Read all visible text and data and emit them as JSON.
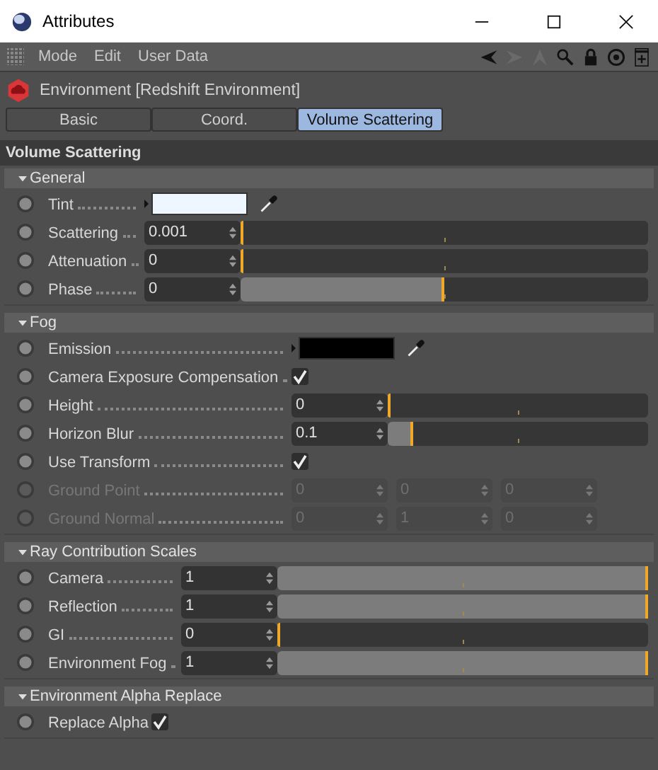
{
  "window": {
    "title": "Attributes"
  },
  "menu": [
    "Mode",
    "Edit",
    "User Data"
  ],
  "object": {
    "title": "Environment [Redshift Environment]"
  },
  "tabs": [
    {
      "label": "Basic",
      "selected": false
    },
    {
      "label": "Coord.",
      "selected": false
    },
    {
      "label": "Volume Scattering",
      "selected": true
    }
  ],
  "panel_title": "Volume Scattering",
  "sections": [
    {
      "title": "General",
      "expanded": true,
      "rows": [
        {
          "kind": "color",
          "label": "Tint",
          "color": "#eef7ff",
          "disabled": false
        },
        {
          "kind": "slider",
          "label": "Scattering",
          "value": "0.001",
          "level": 0,
          "disabled": false
        },
        {
          "kind": "slider",
          "label": "Attenuation",
          "value": "0",
          "level": 0,
          "disabled": false
        },
        {
          "kind": "slider",
          "label": "Phase",
          "value": "0",
          "level": 0.5,
          "disabled": false
        }
      ]
    },
    {
      "title": "Fog",
      "expanded": true,
      "rows": [
        {
          "kind": "color",
          "label": "Emission",
          "color": "#000000",
          "disabled": false
        },
        {
          "kind": "checkbox",
          "label": "Camera Exposure Compensation",
          "checked": true,
          "disabled": false
        },
        {
          "kind": "slider",
          "label": "Height",
          "value": "0",
          "level": 0,
          "disabled": false
        },
        {
          "kind": "slider",
          "label": "Horizon Blur",
          "value": "0.1",
          "level": 0.1,
          "disabled": false
        },
        {
          "kind": "checkbox",
          "label": "Use Transform",
          "checked": true,
          "disabled": false
        },
        {
          "kind": "vector",
          "label": "Ground Point",
          "values": [
            "0",
            "0",
            "0"
          ],
          "disabled": true
        },
        {
          "kind": "vector",
          "label": "Ground Normal",
          "values": [
            "0",
            "1",
            "0"
          ],
          "disabled": true
        }
      ]
    },
    {
      "title": "Ray Contribution Scales",
      "expanded": true,
      "rows": [
        {
          "kind": "slider",
          "label": "Camera",
          "value": "1",
          "level": 1,
          "disabled": false
        },
        {
          "kind": "slider",
          "label": "Reflection",
          "value": "1",
          "level": 1,
          "disabled": false
        },
        {
          "kind": "slider",
          "label": "GI",
          "value": "0",
          "level": 0,
          "disabled": false
        },
        {
          "kind": "slider",
          "label": "Environment Fog",
          "value": "1",
          "level": 1,
          "disabled": false
        }
      ]
    },
    {
      "title": "Environment Alpha Replace",
      "expanded": true,
      "rows": [
        {
          "kind": "checkbox",
          "label": "Replace Alpha",
          "checked": true,
          "disabled": false
        }
      ]
    }
  ]
}
